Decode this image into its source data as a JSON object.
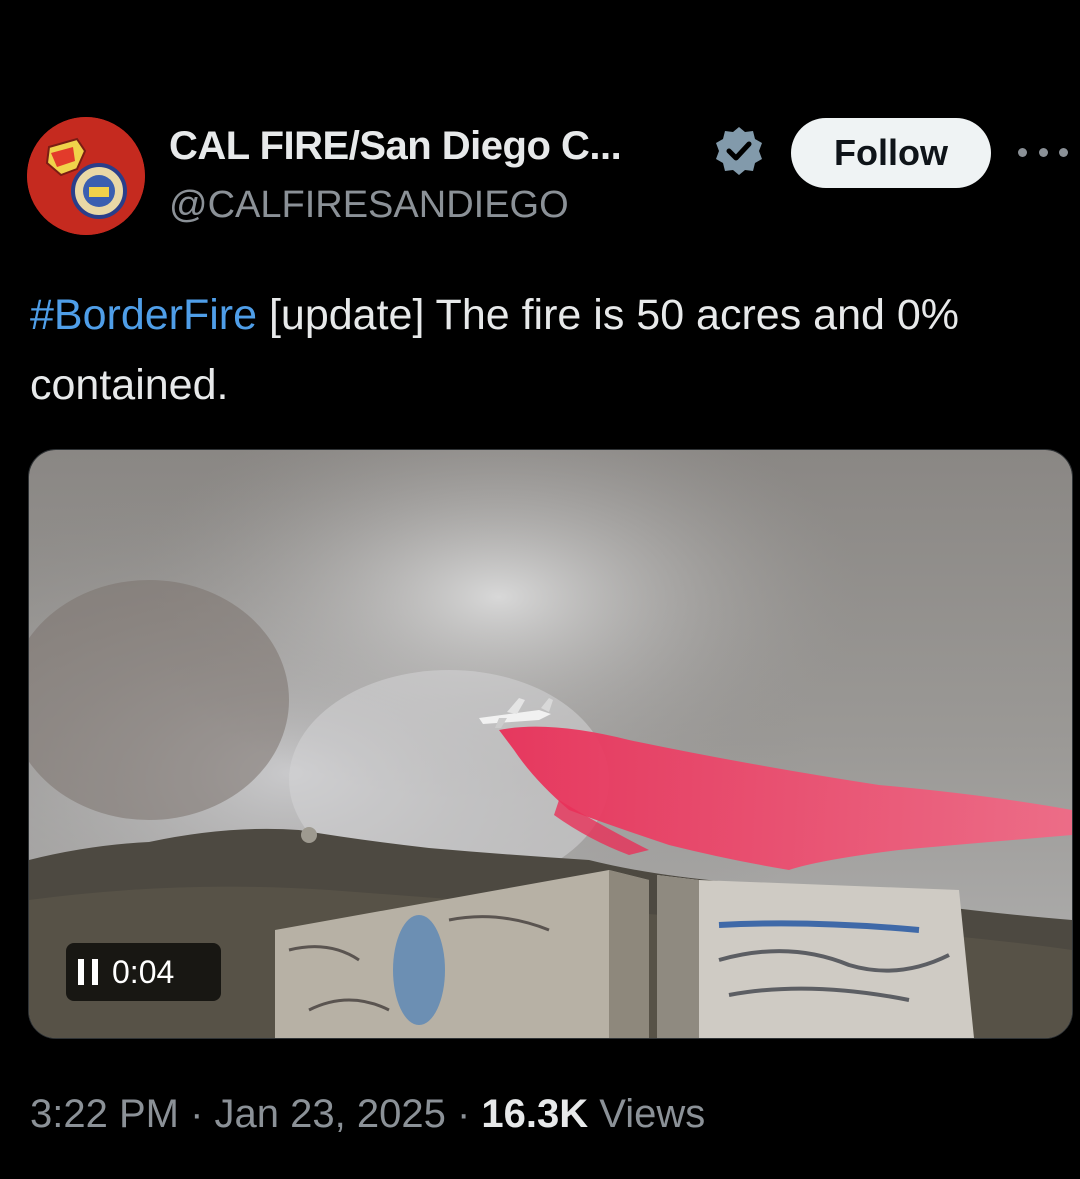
{
  "author": {
    "display_name": "CAL FIRE/San Diego C...",
    "handle": "@CALFIRESANDIEGO",
    "verified": true,
    "avatar_icon": "cal-fire-san-diego-logo"
  },
  "actions": {
    "follow_label": "Follow",
    "more_icon": "more-horizontal-icon"
  },
  "tweet": {
    "hashtag": "#BorderFire",
    "text": " [update] The fire is 50 acres and 0% contained."
  },
  "video": {
    "timer": "0:04",
    "state_icon": "pause-icon"
  },
  "meta": {
    "time": "3:22 PM",
    "separator_1": " · ",
    "date": "Jan 23, 2025",
    "separator_2": " · ",
    "views_count": "16.3K",
    "views_label": " Views"
  },
  "colors": {
    "background": "#000000",
    "text_primary": "#e7e9ea",
    "text_secondary": "#8b9197",
    "link": "#4f9ee8",
    "retardant": "#e8375a"
  }
}
